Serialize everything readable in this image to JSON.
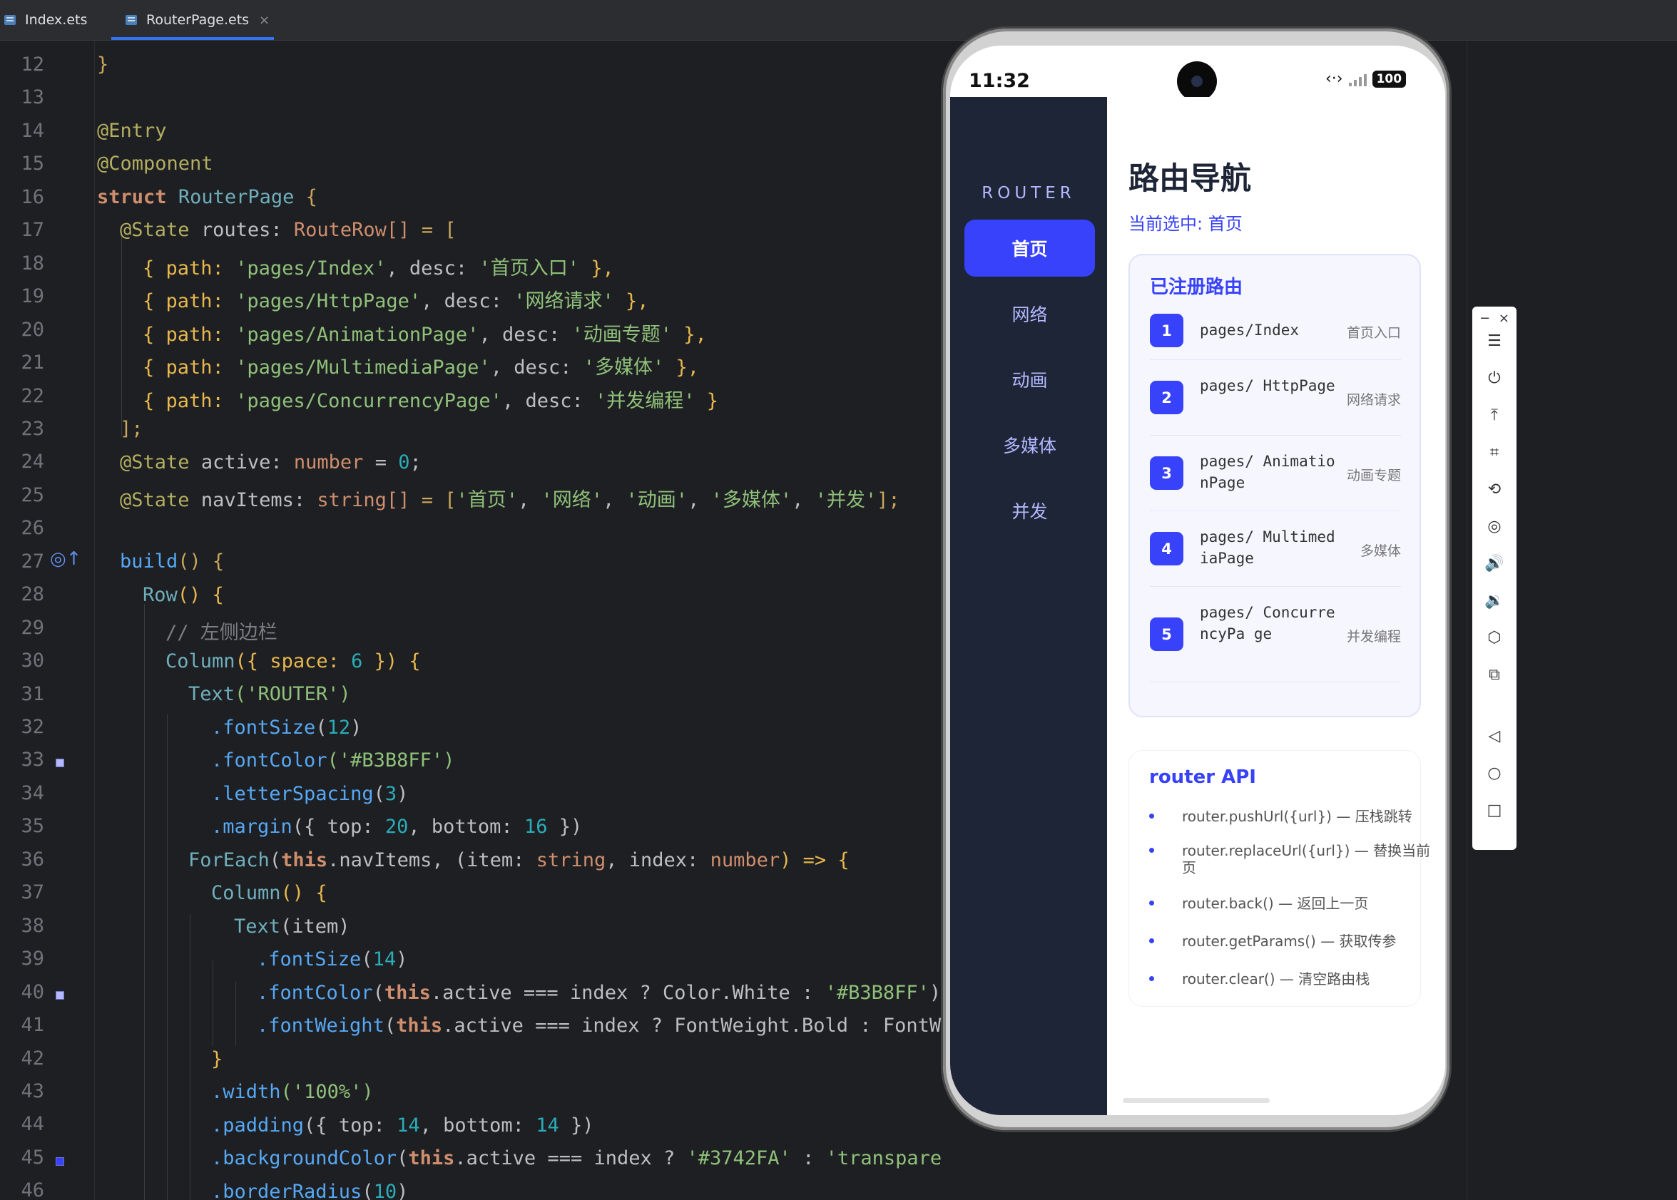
{
  "tabs": [
    {
      "label": "Index.ets",
      "active": false
    },
    {
      "label": "RouterPage.ets",
      "active": true,
      "close": "×"
    }
  ],
  "editor": {
    "line_numbers": [
      "12",
      "13",
      "14",
      "15",
      "16",
      "17",
      "18",
      "19",
      "20",
      "21",
      "22",
      "23",
      "24",
      "25",
      "26",
      "27",
      "28",
      "29",
      "30",
      "31",
      "32",
      "33",
      "34",
      "35",
      "36",
      "37",
      "38",
      "39",
      "40",
      "41",
      "42",
      "43",
      "44",
      "45",
      "46"
    ],
    "lines": {
      "l12": "}",
      "l14": "@Entry",
      "l15": "@Component",
      "l16_k": "struct",
      "l16_n": "RouterPage",
      "l16_b": "{",
      "l17_a": "@State",
      "l17_b": "routes:",
      "l17_c": "RouteRow[]",
      "l17_d": "= [",
      "l18_a": "{ path:",
      "l18_b": "'pages/Index'",
      "l18_c": ", desc:",
      "l18_d": "'首页入口'",
      "l18_e": "},",
      "l19_a": "{ path:",
      "l19_b": "'pages/HttpPage'",
      "l19_c": ", desc:",
      "l19_d": "'网络请求'",
      "l19_e": "},",
      "l20_a": "{ path:",
      "l20_b": "'pages/AnimationPage'",
      "l20_c": ", desc:",
      "l20_d": "'动画专题'",
      "l20_e": "},",
      "l21_a": "{ path:",
      "l21_b": "'pages/MultimediaPage'",
      "l21_c": ", desc:",
      "l21_d": "'多媒体'",
      "l21_e": "},",
      "l22_a": "{ path:",
      "l22_b": "'pages/ConcurrencyPage'",
      "l22_c": ", desc:",
      "l22_d": "'并发编程'",
      "l22_e": "}",
      "l23": "];",
      "l24_a": "@State",
      "l24_b": "active:",
      "l24_c": "number",
      "l24_d": "=",
      "l24_e": "0",
      "l24_f": ";",
      "l25_a": "@State",
      "l25_b": "navItems:",
      "l25_c": "string[]",
      "l25_d": "= [",
      "l25_e": "'首页'",
      "l25_f": "'网络'",
      "l25_g": "'动画'",
      "l25_h": "'多媒体'",
      "l25_i": "'并发'",
      "l25_j": "];",
      "l25_sep": ", ",
      "l27_a": "build",
      "l27_b": "() {",
      "l28_a": "Row",
      "l28_b": "() {",
      "l29": "// 左侧边栏",
      "l30_a": "Column",
      "l30_b": "({ space:",
      "l30_c": "6",
      "l30_d": "}) {",
      "l31_a": "Text",
      "l31_b": "('ROUTER')",
      "l32_a": ".fontSize",
      "l32_b": "(",
      "l32_c": "12",
      "l32_d": ")",
      "l33_a": ".fontColor",
      "l33_b": "('#B3B8FF')",
      "l34_a": ".letterSpacing",
      "l34_b": "(",
      "l34_c": "3",
      "l34_d": ")",
      "l35_a": ".margin",
      "l35_b": "({ top:",
      "l35_c": "20",
      "l35_d": ", bottom:",
      "l35_e": "16",
      "l35_f": "})",
      "l36_a": "ForEach",
      "l36_b": "(",
      "l36_c": "this",
      "l36_d": ".navItems, (item:",
      "l36_e": "string",
      "l36_f": ", index:",
      "l36_g": "number",
      "l36_h": ") => {",
      "l37_a": "Column",
      "l37_b": "() {",
      "l38_a": "Text",
      "l38_b": "(item)",
      "l39_a": ".fontSize",
      "l39_b": "(",
      "l39_c": "14",
      "l39_d": ")",
      "l40_a": ".fontColor",
      "l40_b": "(",
      "l40_c": "this",
      "l40_d": ".active === index ? Color.White :",
      "l40_e": "'#B3B8FF'",
      "l40_f": ")",
      "l41_a": ".fontWeight",
      "l41_b": "(",
      "l41_c": "this",
      "l41_d": ".active === index ? FontWeight.Bold : FontWe",
      "l42": "}",
      "l43_a": ".width",
      "l43_b": "('100%')",
      "l44_a": ".padding",
      "l44_b": "({ top:",
      "l44_c": "14",
      "l44_d": ", bottom:",
      "l44_e": "14",
      "l44_f": "})",
      "l45_a": ".backgroundColor",
      "l45_b": "(",
      "l45_c": "this",
      "l45_d": ".active === index ?",
      "l45_e": "'#3742FA'",
      "l45_f": ":",
      "l45_g": "'transparent'",
      "l45_h": ")",
      "l46_a": ".borderRadius",
      "l46_b": "(",
      "l46_c": "10",
      "l46_d": ")"
    }
  },
  "phone": {
    "time": "11:32",
    "battery": "100",
    "app": {
      "brand": "ROUTER",
      "nav_items": [
        "首页",
        "网络",
        "动画",
        "多媒体",
        "并发"
      ],
      "active_index": 0,
      "title": "路由导航",
      "subtitle": "当前选中: 首页",
      "routes_title": "已注册路由",
      "routes": [
        {
          "num": "1",
          "path": "pages/Index",
          "desc": "首页入口"
        },
        {
          "num": "2",
          "path": "pages/ HttpPage",
          "desc": "网络请求"
        },
        {
          "num": "3",
          "path": "pages/ AnimationPage",
          "desc": "动画专题"
        },
        {
          "num": "4",
          "path": "pages/ MultimediaPage",
          "desc": "多媒体"
        },
        {
          "num": "5",
          "path": "pages/ ConcurrencyPa ge",
          "desc": "并发编程"
        }
      ],
      "api_title": "router API",
      "api_items": [
        "router.pushUrl({url}) — 压栈跳转",
        "router.replaceUrl({url}) — 替换当前页",
        "router.back() — 返回上一页",
        "router.getParams() — 获取传参",
        "router.clear() — 清空路由栈"
      ]
    },
    "colors": {
      "accent": "#3742FA",
      "nav_bg": "#1D2536",
      "nav_text": "#B3B8FF"
    }
  },
  "emulator_toolbar": {
    "top_controls": [
      "−",
      "×"
    ],
    "buttons": [
      {
        "icon": "menu-icon",
        "glyph": "☰"
      },
      {
        "icon": "power-icon",
        "glyph": "⏻"
      },
      {
        "icon": "pin-top-icon",
        "glyph": "⤒"
      },
      {
        "icon": "crop-icon",
        "glyph": "⌗"
      },
      {
        "icon": "rotate-icon",
        "glyph": "⟲"
      },
      {
        "icon": "location-icon",
        "glyph": "◎"
      },
      {
        "icon": "volume-up-icon",
        "glyph": "🔊"
      },
      {
        "icon": "volume-down-icon",
        "glyph": "🔉"
      },
      {
        "icon": "fold-icon",
        "glyph": "⬡"
      },
      {
        "icon": "screenshot-icon",
        "glyph": "⧉"
      },
      {
        "icon": "back-icon",
        "glyph": "◁"
      },
      {
        "icon": "home-icon",
        "glyph": "○"
      },
      {
        "icon": "recents-icon",
        "glyph": "□"
      }
    ]
  }
}
